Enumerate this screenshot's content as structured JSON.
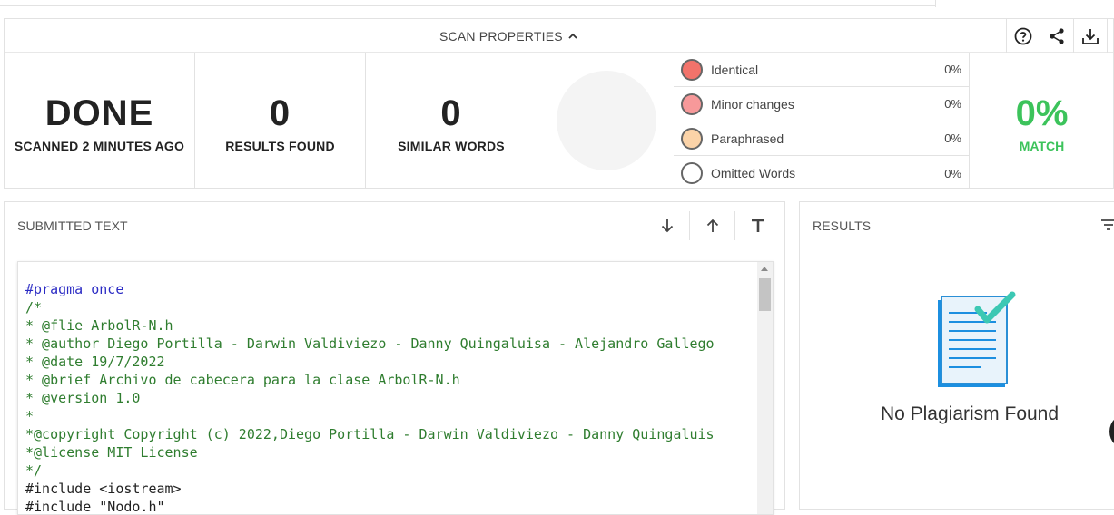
{
  "scan_properties": {
    "title": "SCAN PROPERTIES",
    "icons": [
      "help-icon",
      "share-icon",
      "download-icon",
      "more-icon"
    ]
  },
  "stats": {
    "status": {
      "value": "DONE",
      "label": "SCANNED 2 MINUTES AGO"
    },
    "results": {
      "value": "0",
      "label": "RESULTS FOUND"
    },
    "similar": {
      "value": "0",
      "label": "SIMILAR WORDS"
    }
  },
  "legend": [
    {
      "label": "Identical",
      "pct": "0%",
      "color": "#f2736b"
    },
    {
      "label": "Minor changes",
      "pct": "0%",
      "color": "#f7999a"
    },
    {
      "label": "Paraphrased",
      "pct": "0%",
      "color": "#fbd3a8"
    },
    {
      "label": "Omitted Words",
      "pct": "0%",
      "color": "#ffffff"
    }
  ],
  "match": {
    "value": "0%",
    "label": "MATCH",
    "color": "#3cc35b"
  },
  "submitted": {
    "title": "SUBMITTED TEXT",
    "code_lines": [
      "#pragma once",
      "/*",
      "* @flie ArbolR-N.h",
      "* @author Diego Portilla - Darwin Valdiviezo - Danny Quingaluisa - Alejandro Gallego",
      "* @date 19/7/2022",
      "* @brief Archivo de cabecera para la clase ArbolR-N.h",
      "* @version 1.0",
      "*",
      "*@copyright Copyright (c) 2022,Diego Portilla - Darwin Valdiviezo - Danny Quingaluis",
      "*@license MIT License",
      "*/",
      "#include <iostream>",
      "#include \"Nodo.h\""
    ]
  },
  "results": {
    "title": "RESULTS",
    "empty_text": "No Plagiarism Found"
  }
}
